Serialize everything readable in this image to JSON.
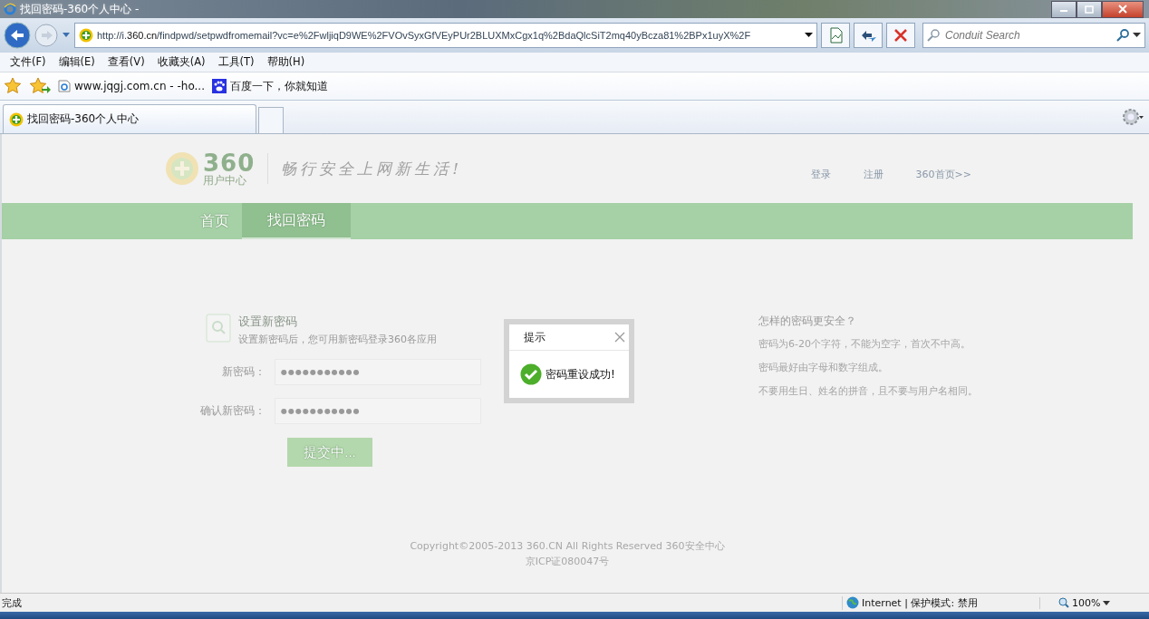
{
  "window": {
    "title": "找回密码-360个人中心 -"
  },
  "address_bar": {
    "url": "http://i.360.cn/findpwd/setpwdfromemail?vc=e%2FwljiqD9WE%2FVOvSyxGfVEyPUr2BLUXMxCgx1q%2BdaQlcSiT2mq40yBcza81%2BPx1uyX%2F"
  },
  "search": {
    "placeholder": "Conduit Search"
  },
  "menu": [
    "文件(F)",
    "编辑(E)",
    "查看(V)",
    "收藏夹(A)",
    "工具(T)",
    "帮助(H)"
  ],
  "favorites": [
    "www.jqgj.com.cn - -ho...",
    "百度一下，你就知道"
  ],
  "tabs": [
    {
      "label": "找回密码-360个人中心",
      "selected": true
    }
  ],
  "page": {
    "logo_text": "360",
    "logo_sub": "用户中心",
    "slogan": "畅行安全上网新生活!",
    "top_links": [
      "登录",
      "注册",
      "360首页>>"
    ],
    "nav": [
      {
        "label": "首页",
        "selected": false
      },
      {
        "label": "找回密码",
        "selected": true
      }
    ],
    "form": {
      "title": "设置新密码",
      "subtitle": "设置新密码后，您可用新密码登录360各应用",
      "fields": [
        {
          "label": "新密码：",
          "value": "●●●●●●●●●●●"
        },
        {
          "label": "确认新密码：",
          "value": "●●●●●●●●●●●"
        }
      ],
      "submit": "提交中..."
    },
    "tips": {
      "title": "怎样的密码更安全？",
      "items": [
        "密码为6-20个字符，不能为空字，首次不中高。",
        "密码最好由字母和数字组成。",
        "不要用生日、姓名的拼音，且不要与用户名相同。"
      ]
    },
    "footer": [
      "Copyright©2005-2013 360.CN All Rights Reserved 360安全中心",
      "京ICP证080047号"
    ]
  },
  "dialog": {
    "title": "提示",
    "message": "密码重设成功!"
  },
  "status_bar": {
    "text": "完成",
    "zone": "Internet | 保护模式: 禁用",
    "zoom": "100%"
  }
}
